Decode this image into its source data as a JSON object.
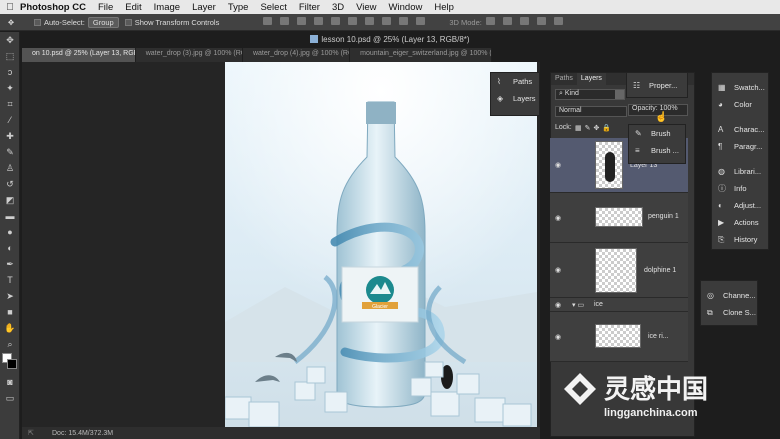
{
  "menubar": {
    "app": "Photoshop CC",
    "items": [
      "File",
      "Edit",
      "Image",
      "Layer",
      "Type",
      "Select",
      "Filter",
      "3D",
      "View",
      "Window",
      "Help"
    ]
  },
  "options": {
    "auto_select": "Auto-Select:",
    "auto_select_value": "Group",
    "transform": "Show Transform Controls",
    "mode3d": "3D Mode:"
  },
  "document": {
    "title": "lesson 10.psd @ 25% (Layer 13, RGB/8*)",
    "status": "Doc: 15.4M/372.3M"
  },
  "tabs": [
    "on 10.psd @ 25% (Layer 13, RGB/8*) *",
    "water_drop (3).jpg @ 100% (RGB/8)",
    "water_drop (4).jpg @ 100% (RGB/8)",
    "mountain_eiger_switzerland.jpg @ 100% (RGB/8#)"
  ],
  "float_panel": {
    "items": [
      {
        "icon": "paths-icon",
        "label": "Paths"
      },
      {
        "icon": "layers-icon",
        "label": "Layers"
      }
    ]
  },
  "layers_panel": {
    "tabs": [
      "Paths",
      "Layers"
    ],
    "kind": "Kind",
    "blend": "Normal",
    "opacity_label": "Opacity:",
    "opacity": "100%",
    "lock_label": "Lock:",
    "layers": [
      {
        "name": "Layer 13"
      },
      {
        "name": "penguin 1"
      },
      {
        "name": "dolphine 1"
      },
      {
        "name": "ice"
      },
      {
        "name": "ice ri..."
      }
    ]
  },
  "props_panel": {
    "label": "Proper...",
    "items": [
      {
        "label": "Brush"
      },
      {
        "label": "Brush ..."
      }
    ]
  },
  "right_panel": {
    "items": [
      {
        "icon": "swatches-icon",
        "label": "Swatch..."
      },
      {
        "icon": "color-icon",
        "label": "Color"
      },
      {
        "icon": "character-icon",
        "label": "Charac..."
      },
      {
        "icon": "paragraph-icon",
        "label": "Paragr..."
      },
      {
        "icon": "libraries-icon",
        "label": "Librari..."
      },
      {
        "icon": "info-icon",
        "label": "Info"
      },
      {
        "icon": "adjustments-icon",
        "label": "Adjust..."
      },
      {
        "icon": "actions-icon",
        "label": "Actions"
      },
      {
        "icon": "history-icon",
        "label": "History"
      }
    ]
  },
  "right_panel2": {
    "items": [
      {
        "icon": "channels-icon",
        "label": "Channe..."
      },
      {
        "icon": "clone-source-icon",
        "label": "Clone S..."
      }
    ]
  },
  "label_text": "Glacier",
  "watermark": {
    "name": "灵感中国",
    "url": "lingganchina.com"
  }
}
